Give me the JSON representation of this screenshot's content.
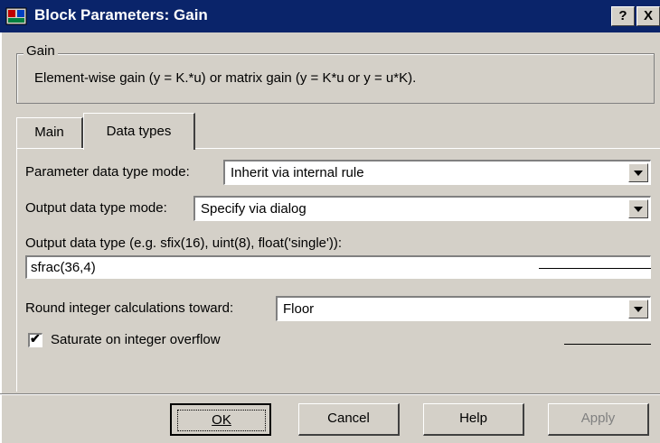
{
  "window": {
    "title": "Block Parameters: Gain",
    "help_glyph": "?",
    "close_glyph": "X"
  },
  "gain_group": {
    "label": "Gain",
    "description": "Element-wise gain (y = K.*u) or matrix gain (y = K*u or y = u*K)."
  },
  "tabs": [
    {
      "label": "Main",
      "selected": false
    },
    {
      "label": "Data types",
      "selected": true
    }
  ],
  "form": {
    "param_mode_label": "Parameter data type mode:",
    "param_mode_value": "Inherit via internal rule",
    "output_mode_label": "Output data type mode:",
    "output_mode_value": "Specify via dialog",
    "output_type_label": "Output data type (e.g. sfix(16), uint(8), float('single')):",
    "output_type_value": "sfrac(36,4)",
    "round_label": "Round integer calculations toward:",
    "round_value": "Floor",
    "saturate_label": "Saturate on integer overflow",
    "saturate_checked": true,
    "check_glyph": "✔"
  },
  "buttons": {
    "ok": "OK",
    "cancel": "Cancel",
    "help": "Help",
    "apply": "Apply"
  },
  "colors": {
    "titlebar": "#0a246a",
    "face": "#d4d0c8"
  }
}
